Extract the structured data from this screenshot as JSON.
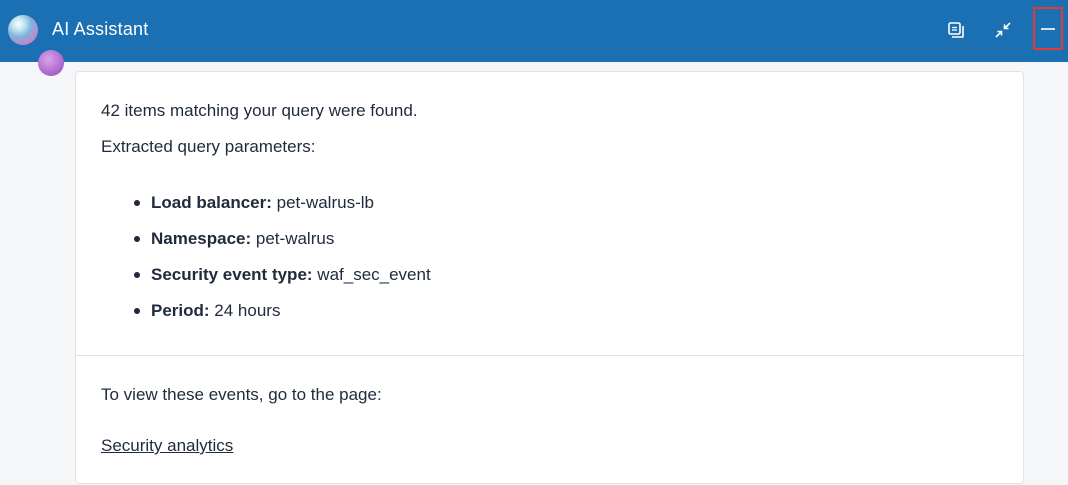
{
  "header": {
    "title": "AI Assistant",
    "buttons": {
      "popout_icon": "popout-icon",
      "collapse_icon": "collapse-icon",
      "minimize_icon": "minimize-icon"
    },
    "colors": {
      "bar": "#1a70b3",
      "highlight": "#e53935"
    }
  },
  "message": {
    "summary": "42 items matching your query were found.",
    "params_heading": "Extracted query parameters:",
    "params": [
      {
        "key": "Load balancer:",
        "value": " pet-walrus-lb"
      },
      {
        "key": "Namespace:",
        "value": " pet-walrus"
      },
      {
        "key": "Security event type:",
        "value": " waf_sec_event"
      },
      {
        "key": "Period:",
        "value": " 24 hours"
      }
    ],
    "footer_text": "To view these events, go to the page:",
    "link_label": "Security analytics"
  }
}
